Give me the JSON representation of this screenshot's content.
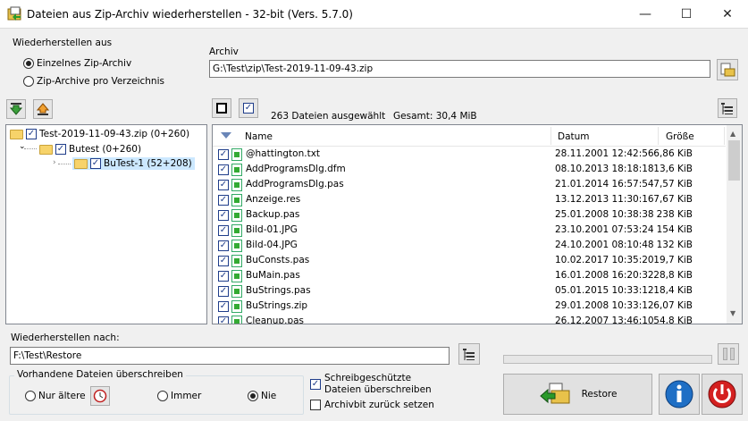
{
  "window": {
    "title": "Dateien aus Zip-Archiv wiederherstellen - 32-bit (Vers. 5.7.0)",
    "minimize": "—",
    "maximize": "☐",
    "close": "✕"
  },
  "source": {
    "label": "Wiederherstellen aus",
    "option_single": "Einzelnes Zip-Archiv",
    "option_per_dir": "Zip-Archive pro Verzeichnis"
  },
  "archive": {
    "label": "Archiv",
    "path": "G:\\Test\\zip\\Test-2019-11-09-43.zip"
  },
  "status": {
    "selected": "263 Dateien ausgewählt",
    "total": "Gesamt: 30,4 MiB"
  },
  "tree": {
    "root": "Test-2019-11-09-43.zip (0+260)",
    "child": "Butest (0+260)",
    "grandchild": "BuTest-1 (52+208)"
  },
  "columns": {
    "name": "Name",
    "date": "Datum",
    "size": "Größe"
  },
  "files": [
    {
      "name": "@hattington.txt",
      "date": "28.11.2001 12:42:56",
      "size": "6,86 KiB"
    },
    {
      "name": "AddProgramsDlg.dfm",
      "date": "08.10.2013 18:18:18",
      "size": "13,6 KiB"
    },
    {
      "name": "AddProgramsDlg.pas",
      "date": "21.01.2014 16:57:54",
      "size": "7,57 KiB"
    },
    {
      "name": "Anzeige.res",
      "date": "13.12.2013 11:30:16",
      "size": "7,67 KiB"
    },
    {
      "name": "Backup.pas",
      "date": "25.01.2008 10:38:38",
      "size": "238 KiB"
    },
    {
      "name": "Bild-01.JPG",
      "date": "23.10.2001 07:53:24",
      "size": "154 KiB"
    },
    {
      "name": "Bild-04.JPG",
      "date": "24.10.2001 08:10:48",
      "size": "132 KiB"
    },
    {
      "name": "BuConsts.pas",
      "date": "10.02.2017 10:35:20",
      "size": "19,7 KiB"
    },
    {
      "name": "BuMain.pas",
      "date": "16.01.2008 16:20:32",
      "size": "28,8 KiB"
    },
    {
      "name": "BuStrings.pas",
      "date": "05.01.2015 10:33:12",
      "size": "18,4 KiB"
    },
    {
      "name": "BuStrings.zip",
      "date": "29.01.2008 10:33:12",
      "size": "6,07 KiB"
    },
    {
      "name": "Cleanup.pas",
      "date": "26.12.2007 13:46:10",
      "size": "54,8 KiB"
    }
  ],
  "restore_to": {
    "label": "Wiederherstellen nach:",
    "path": "F:\\Test\\Restore"
  },
  "overwrite": {
    "label": "Vorhandene Dateien überschreiben",
    "older": "Nur ältere",
    "always": "Immer",
    "never": "Nie"
  },
  "options": {
    "readonly": "Schreibgeschützte Dateien überschreiben",
    "archivebit": "Archivbit zurück setzen"
  },
  "buttons": {
    "restore": "Restore"
  },
  "colors": {
    "selection": "#cce8ff",
    "accent": "#1f6fc5",
    "power": "#d42020"
  }
}
